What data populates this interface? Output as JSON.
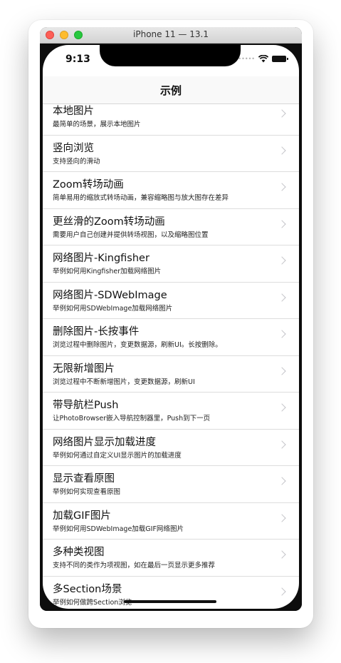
{
  "window": {
    "title": "iPhone 11 — 13.1"
  },
  "status_bar": {
    "time": "9:13",
    "icons": [
      "signal-dots-icon",
      "wifi-icon",
      "battery-icon"
    ]
  },
  "nav": {
    "title": "示例"
  },
  "rows": [
    {
      "title": "本地图片",
      "subtitle": "最简单的场景，展示本地图片"
    },
    {
      "title": "竖向浏览",
      "subtitle": "支持竖向的滑动"
    },
    {
      "title": "Zoom转场动画",
      "subtitle": "简单易用的缩放式转场动画，兼容缩略图与放大图存在差异"
    },
    {
      "title": "更丝滑的Zoom转场动画",
      "subtitle": "需要用户自己创建并提供转场视图，以及缩略图位置"
    },
    {
      "title": "网络图片-Kingfisher",
      "subtitle": "举例如何用Kingfisher加载网络图片"
    },
    {
      "title": "网络图片-SDWebImage",
      "subtitle": "举例如何用SDWebImage加载网络图片"
    },
    {
      "title": "删除图片-长按事件",
      "subtitle": "浏览过程中删除图片，变更数据源，刷新UI。长按删除。"
    },
    {
      "title": "无限新增图片",
      "subtitle": "浏览过程中不断新增图片，变更数据源，刷新UI"
    },
    {
      "title": "带导航栏Push",
      "subtitle": "让PhotoBrowser嵌入导航控制器里，Push到下一页"
    },
    {
      "title": "网络图片显示加载进度",
      "subtitle": "举例如何通过自定义UI显示图片的加载进度"
    },
    {
      "title": "显示查看原图",
      "subtitle": "举例如何实现查看原图"
    },
    {
      "title": "加载GIF图片",
      "subtitle": "举例如何用SDWebImage加载GIF网络图片"
    },
    {
      "title": "多种类视图",
      "subtitle": "支持不同的类作为项视图，如在最后一页显示更多推荐"
    },
    {
      "title": "多Section场景",
      "subtitle": "举例如何做跨Section浏览"
    }
  ]
}
